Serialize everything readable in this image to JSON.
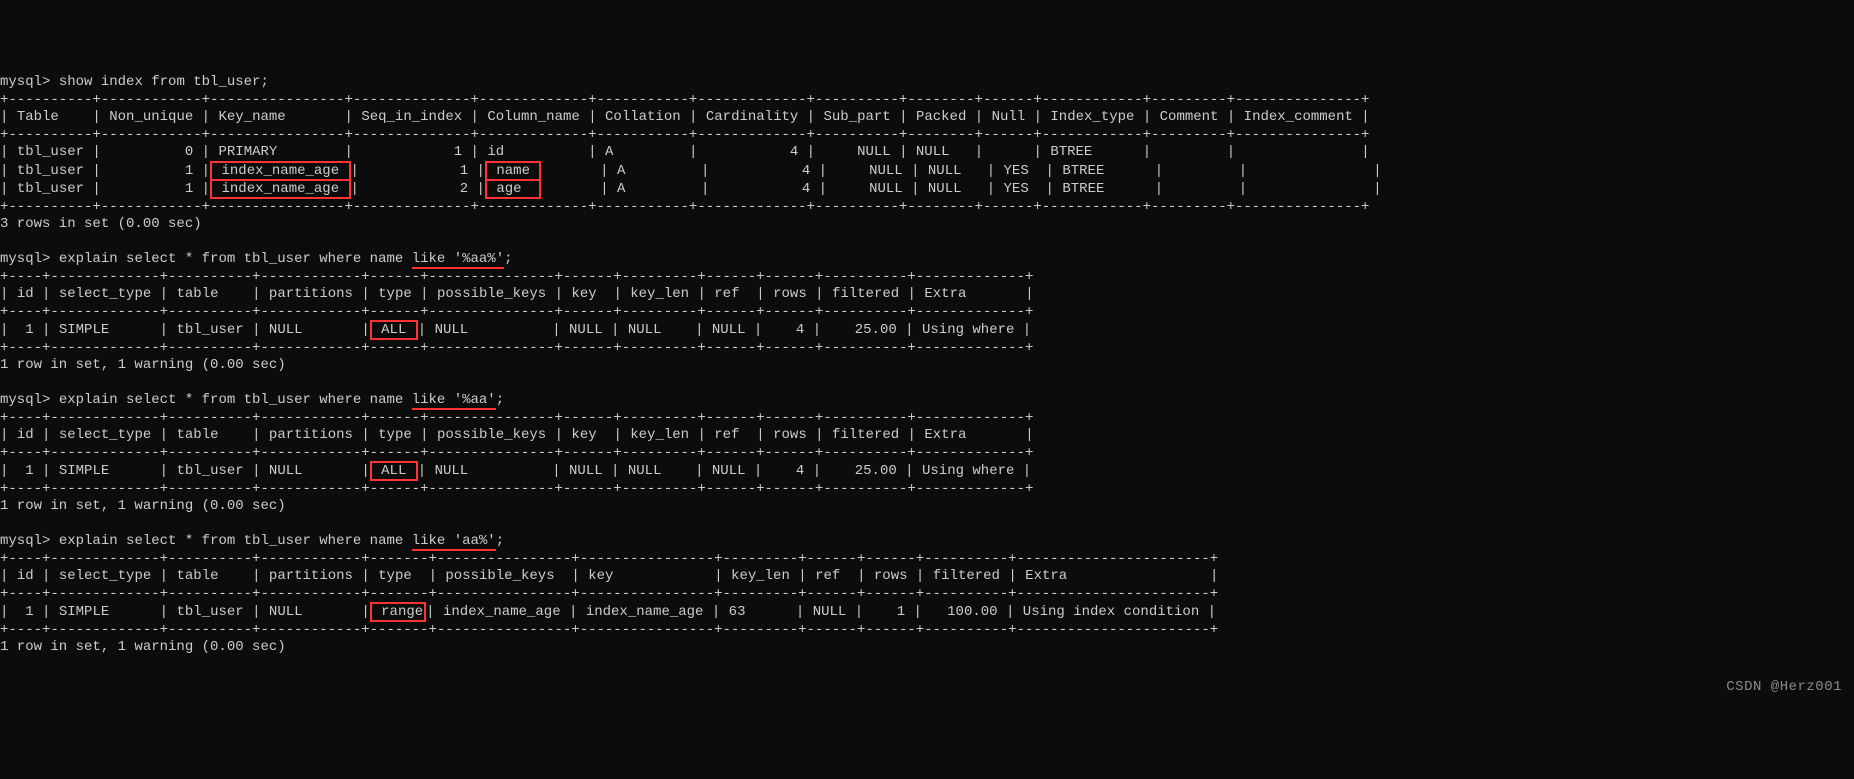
{
  "prompt": "mysql>",
  "cmd1": "show index from tbl_user;",
  "idx": {
    "headers": [
      "Table",
      "Non_unique",
      "Key_name",
      "Seq_in_index",
      "Column_name",
      "Collation",
      "Cardinality",
      "Sub_part",
      "Packed",
      "Null",
      "Index_type",
      "Comment",
      "Index_comment"
    ],
    "rows": [
      {
        "Table": "tbl_user",
        "Non_unique": "0",
        "Key_name": "PRIMARY",
        "Seq_in_index": "1",
        "Column_name": "id",
        "Collation": "A",
        "Cardinality": "4",
        "Sub_part": "NULL",
        "Packed": "NULL",
        "Null": "",
        "Index_type": "BTREE",
        "Comment": "",
        "Index_comment": ""
      },
      {
        "Table": "tbl_user",
        "Non_unique": "1",
        "Key_name": "index_name_age",
        "Seq_in_index": "1",
        "Column_name": "name",
        "Collation": "A",
        "Cardinality": "4",
        "Sub_part": "NULL",
        "Packed": "NULL",
        "Null": "YES",
        "Index_type": "BTREE",
        "Comment": "",
        "Index_comment": ""
      },
      {
        "Table": "tbl_user",
        "Non_unique": "1",
        "Key_name": "index_name_age",
        "Seq_in_index": "2",
        "Column_name": "age",
        "Collation": "A",
        "Cardinality": "4",
        "Sub_part": "NULL",
        "Packed": "NULL",
        "Null": "YES",
        "Index_type": "BTREE",
        "Comment": "",
        "Index_comment": ""
      }
    ],
    "summary": "3 rows in set (0.00 sec)"
  },
  "q2": {
    "cmd_prefix": "explain select * from tbl_user where name ",
    "cmd_hl": "like '%aa%'",
    "cmd_suffix": ";",
    "headers": [
      "id",
      "select_type",
      "table",
      "partitions",
      "type",
      "possible_keys",
      "key",
      "key_len",
      "ref",
      "rows",
      "filtered",
      "Extra"
    ],
    "row": {
      "id": "1",
      "select_type": "SIMPLE",
      "table": "tbl_user",
      "partitions": "NULL",
      "type": "ALL",
      "possible_keys": "NULL",
      "key": "NULL",
      "key_len": "NULL",
      "ref": "NULL",
      "rows": "4",
      "filtered": "25.00",
      "Extra": "Using where"
    },
    "summary": "1 row in set, 1 warning (0.00 sec)"
  },
  "q3": {
    "cmd_prefix": "explain select * from tbl_user where name ",
    "cmd_hl": "like '%aa'",
    "cmd_suffix": ";",
    "headers": [
      "id",
      "select_type",
      "table",
      "partitions",
      "type",
      "possible_keys",
      "key",
      "key_len",
      "ref",
      "rows",
      "filtered",
      "Extra"
    ],
    "row": {
      "id": "1",
      "select_type": "SIMPLE",
      "table": "tbl_user",
      "partitions": "NULL",
      "type": "ALL",
      "possible_keys": "NULL",
      "key": "NULL",
      "key_len": "NULL",
      "ref": "NULL",
      "rows": "4",
      "filtered": "25.00",
      "Extra": "Using where"
    },
    "summary": "1 row in set, 1 warning (0.00 sec)"
  },
  "q4": {
    "cmd_prefix": "explain select * from tbl_user where name ",
    "cmd_hl": "like 'aa%'",
    "cmd_suffix": ";",
    "headers": [
      "id",
      "select_type",
      "table",
      "partitions",
      "type",
      "possible_keys",
      "key",
      "key_len",
      "ref",
      "rows",
      "filtered",
      "Extra"
    ],
    "row": {
      "id": "1",
      "select_type": "SIMPLE",
      "table": "tbl_user",
      "partitions": "NULL",
      "type": "range",
      "possible_keys": "index_name_age",
      "key": "index_name_age",
      "key_len": "63",
      "ref": "NULL",
      "rows": "1",
      "filtered": "100.00",
      "Extra": "Using index condition"
    },
    "summary": "1 row in set, 1 warning (0.00 sec)"
  },
  "watermark": "CSDN @Herz001"
}
